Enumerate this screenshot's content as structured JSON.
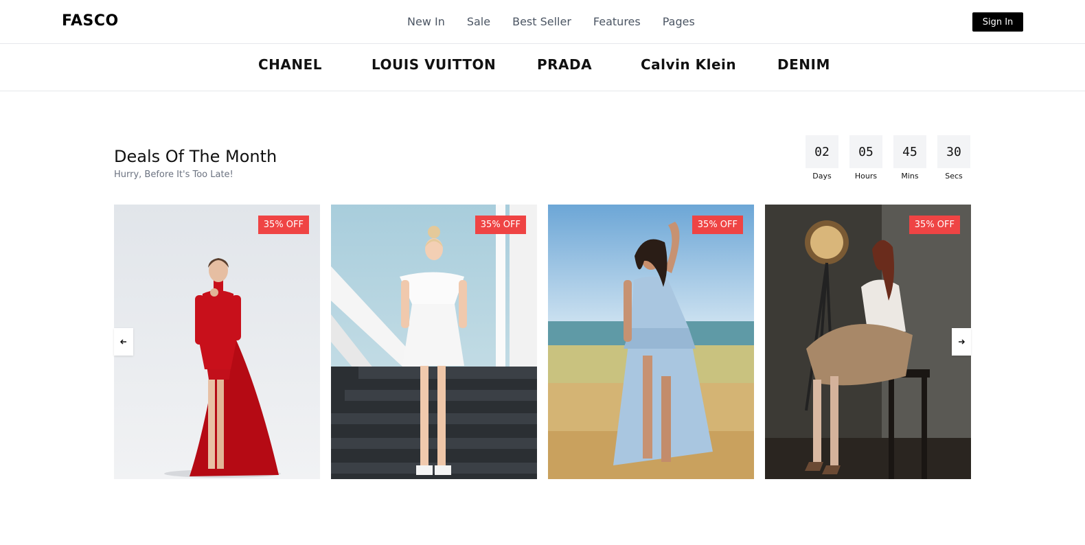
{
  "header": {
    "logo": "FASCO",
    "nav": [
      "New In",
      "Sale",
      "Best Seller",
      "Features",
      "Pages"
    ],
    "signin_label": "Sign In"
  },
  "brands": [
    "CHANEL",
    "LOUIS VUITTON",
    "PRADA",
    "Calvin Klein",
    "DENIM"
  ],
  "deals": {
    "title": "Deals Of The Month",
    "subtitle": "Hurry, Before It's Too Late!",
    "countdown": [
      {
        "value": "02",
        "label": "Days"
      },
      {
        "value": "05",
        "label": "Hours"
      },
      {
        "value": "45",
        "label": "Mins"
      },
      {
        "value": "30",
        "label": "Secs"
      }
    ],
    "products": [
      {
        "badge": "35% OFF",
        "image": "woman-red-dress"
      },
      {
        "badge": "35% OFF",
        "image": "woman-white-dress-stairs"
      },
      {
        "badge": "35% OFF",
        "image": "woman-blue-dress-beach"
      },
      {
        "badge": "35% OFF",
        "image": "woman-pleated-skirt-studio"
      }
    ],
    "carousel": {
      "prev_icon": "arrow-left-icon",
      "next_icon": "arrow-right-icon"
    }
  },
  "colors": {
    "badge": "#ef4444",
    "signin_bg": "#000000",
    "timer_bg": "#f3f4f6"
  }
}
